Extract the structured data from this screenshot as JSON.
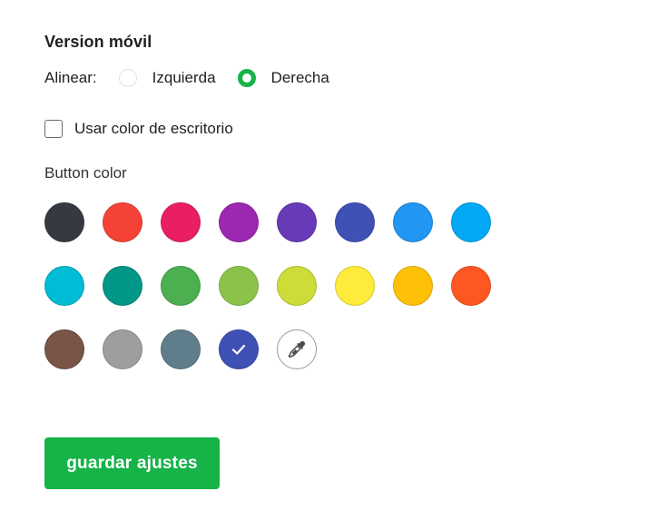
{
  "section": {
    "title": "Version móvil"
  },
  "align": {
    "label": "Alinear:",
    "options": [
      {
        "label": "Izquierda",
        "selected": false
      },
      {
        "label": "Derecha",
        "selected": true
      }
    ]
  },
  "desktop_color": {
    "label": "Usar color de escritorio",
    "checked": false
  },
  "button_color": {
    "label": "Button color",
    "swatches": [
      "#353a40",
      "#f44336",
      "#e91e63",
      "#9c27b0",
      "#673ab7",
      "#3f51b5",
      "#2196f3",
      "#03a9f4",
      "#00bcd4",
      "#009688",
      "#4caf50",
      "#8bc34a",
      "#cddc39",
      "#ffeb3b",
      "#ffc107",
      "#ff5722",
      "#795548",
      "#9e9e9e",
      "#607d8b",
      "#3f51b5"
    ],
    "selected_index": 19,
    "selected_icon": "checkmark-icon",
    "picker_icon": "eyedropper-icon"
  },
  "colors": {
    "accent": "#16b348"
  },
  "actions": {
    "save_label": "guardar ajustes"
  }
}
